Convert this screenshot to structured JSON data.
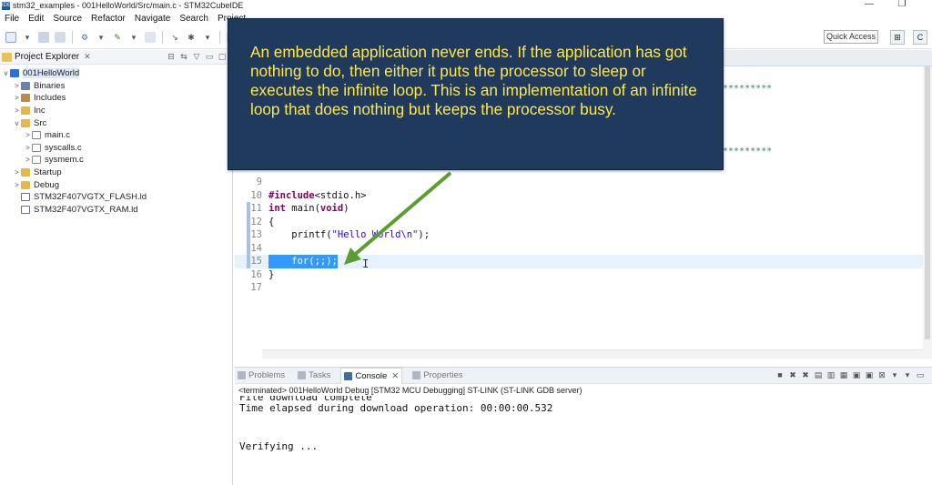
{
  "window": {
    "title": "stm32_examples - 001HelloWorld/Src/main.c - STM32CubeIDE",
    "app_icon": "IDE"
  },
  "menu": [
    "File",
    "Edit",
    "Source",
    "Refactor",
    "Navigate",
    "Search",
    "Project"
  ],
  "toolbar": {
    "quick_access": "Quick Access"
  },
  "explorer": {
    "title": "Project Explorer",
    "tree": [
      {
        "label": "001HelloWorld",
        "icon": "project-icon",
        "twisty": "v",
        "indent": 0
      },
      {
        "label": "Binaries",
        "icon": "binaries-icon",
        "twisty": ">",
        "indent": 1
      },
      {
        "label": "Includes",
        "icon": "includes-icon",
        "twisty": ">",
        "indent": 1
      },
      {
        "label": "Inc",
        "icon": "folder-icon",
        "twisty": ">",
        "indent": 1
      },
      {
        "label": "Src",
        "icon": "folder-icon",
        "twisty": "v",
        "indent": 1
      },
      {
        "label": "main.c",
        "icon": "c-file-icon",
        "twisty": ">",
        "indent": 2
      },
      {
        "label": "syscalls.c",
        "icon": "c-file-icon",
        "twisty": ">",
        "indent": 2
      },
      {
        "label": "sysmem.c",
        "icon": "c-file-icon",
        "twisty": ">",
        "indent": 2
      },
      {
        "label": "Startup",
        "icon": "folder-icon",
        "twisty": ">",
        "indent": 1
      },
      {
        "label": "Debug",
        "icon": "folder-icon",
        "twisty": ">",
        "indent": 1
      },
      {
        "label": "STM32F407VGTX_FLASH.ld",
        "icon": "linker-file-icon",
        "twisty": "",
        "indent": 1
      },
      {
        "label": "STM32F407VGTX_RAM.ld",
        "icon": "linker-file-icon",
        "twisty": "",
        "indent": 1
      }
    ]
  },
  "editor": {
    "stars_a": "*********",
    "stars_b": "*********",
    "lines": [
      {
        "n": "9",
        "code": ""
      },
      {
        "n": "10",
        "code": "#include<stdio.h>"
      },
      {
        "n": "11",
        "code": "int main(void)"
      },
      {
        "n": "12",
        "code": "{"
      },
      {
        "n": "13",
        "code": "    printf(\"Hello World\\n\");"
      },
      {
        "n": "14",
        "code": ""
      },
      {
        "n": "15",
        "code": "    for(;;);"
      },
      {
        "n": "16",
        "code": "}"
      },
      {
        "n": "17",
        "code": ""
      }
    ]
  },
  "console": {
    "tabs": [
      "Problems",
      "Tasks",
      "Console",
      "Properties"
    ],
    "active_tab": "Console",
    "status": "<terminated> 001HelloWorld Debug [STM32 MCU Debugging] ST-LINK (ST-LINK GDB server)",
    "output": [
      "File download complete",
      "Time elapsed during download operation: 00:00:00.532",
      "",
      "",
      "Verifying ..."
    ]
  },
  "callout": {
    "text": "An embedded application never ends. If the application has got nothing to do, then either it puts the processor to sleep or executes the infinite loop. This is an implementation of an infinite loop that does nothing but keeps the processor busy."
  },
  "colors": {
    "callout_bg": "#1f3a5c",
    "callout_text": "#ffe84a",
    "arrow": "#5a9e2f",
    "selection": "#3399ff"
  }
}
